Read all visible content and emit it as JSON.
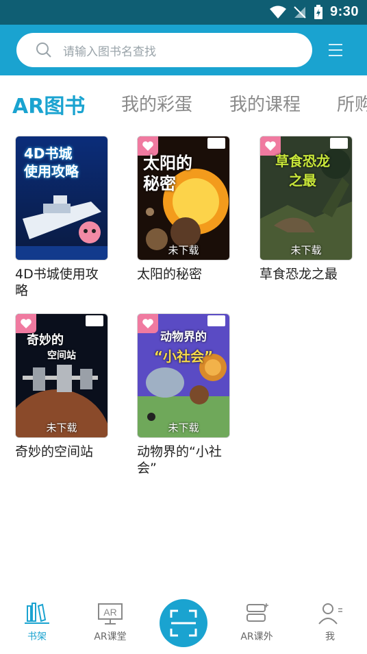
{
  "status_bar": {
    "time": "9:30"
  },
  "search": {
    "placeholder": "请输入图书名查找"
  },
  "tabs": [
    {
      "label": "AR图书"
    },
    {
      "label": "我的彩蛋"
    },
    {
      "label": "我的课程"
    },
    {
      "label": "所购"
    }
  ],
  "books": [
    {
      "title": "4D书城使用攻略",
      "cover_text": [
        "4D书城",
        "使用攻略"
      ],
      "download_status": ""
    },
    {
      "title": "太阳的秘密",
      "cover_text": [
        "太阳的",
        "秘密"
      ],
      "download_status": "未下载"
    },
    {
      "title": "草食恐龙之最",
      "cover_text": [
        "草食恐龙",
        "之最"
      ],
      "download_status": "未下载"
    },
    {
      "title": "奇妙的空间站",
      "cover_text": [
        "奇妙的",
        "空间站"
      ],
      "download_status": "未下载"
    },
    {
      "title": "动物界的“小社会”",
      "cover_text": [
        "动物界的",
        "“小社会”"
      ],
      "download_status": "未下载"
    }
  ],
  "bottom_nav": [
    {
      "label": "书架",
      "icon": "bookshelf-icon",
      "active": true
    },
    {
      "label": "AR课堂",
      "icon": "ar-classroom-icon"
    },
    {
      "label": "",
      "icon": "scan-icon"
    },
    {
      "label": "AR课外",
      "icon": "ar-extracurricular-icon"
    },
    {
      "label": "我",
      "icon": "profile-icon"
    }
  ],
  "colors": {
    "accent": "#1aa3d0",
    "status_bar": "#0f5e73",
    "badge": "#f07aa0"
  }
}
